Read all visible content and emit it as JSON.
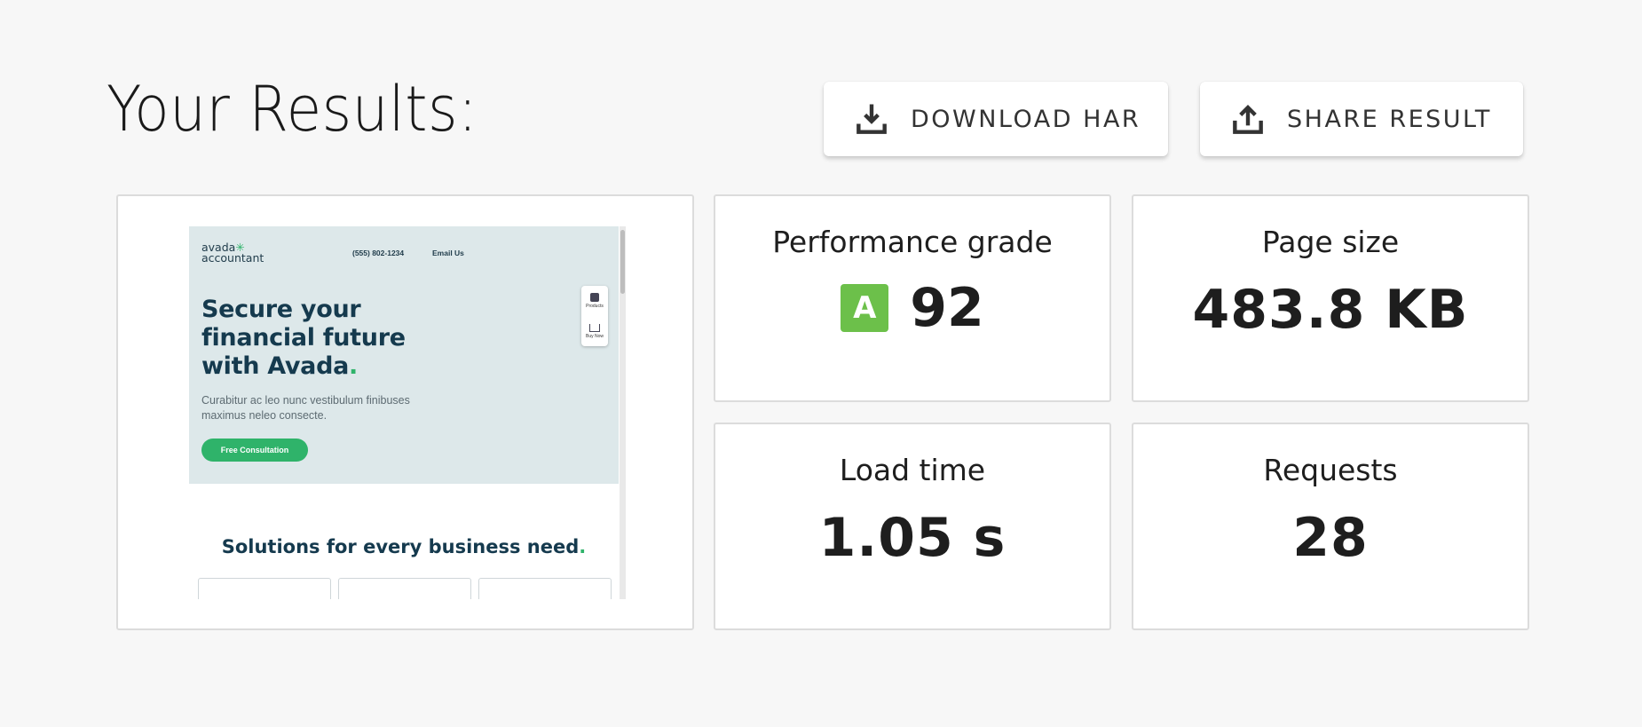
{
  "page": {
    "title": "Your Results:"
  },
  "actions": {
    "download_label": "DOWNLOAD HAR",
    "share_label": "SHARE RESULT"
  },
  "preview": {
    "logo_line1": "avada",
    "logo_line2": "accountant",
    "phone": "(555) 802-1234",
    "email_link": "Email Us",
    "hero_line1": "Secure your",
    "hero_line2": "financial future",
    "hero_line3": "with Avada",
    "hero_line3_dot": ".",
    "hero_sub": "Curabitur ac leo nunc vestibulum finibuses maximus neleo consecte.",
    "cta_label": "Free Consultation",
    "widget_item1": "Products",
    "widget_item2": "Buy Now",
    "solutions_title": "Solutions for every business need",
    "solutions_dot": "."
  },
  "metrics": {
    "performance": {
      "label": "Performance grade",
      "grade": "A",
      "score": "92"
    },
    "page_size": {
      "label": "Page size",
      "value": "483.8 KB"
    },
    "load_time": {
      "label": "Load time",
      "value": "1.05 s"
    },
    "requests": {
      "label": "Requests",
      "value": "28"
    }
  },
  "colors": {
    "grade_a": "#6cc04a",
    "brand_green": "#2fb36a",
    "brand_navy": "#153a4e"
  },
  "icons": {
    "download": "download-icon",
    "share": "share-icon"
  }
}
